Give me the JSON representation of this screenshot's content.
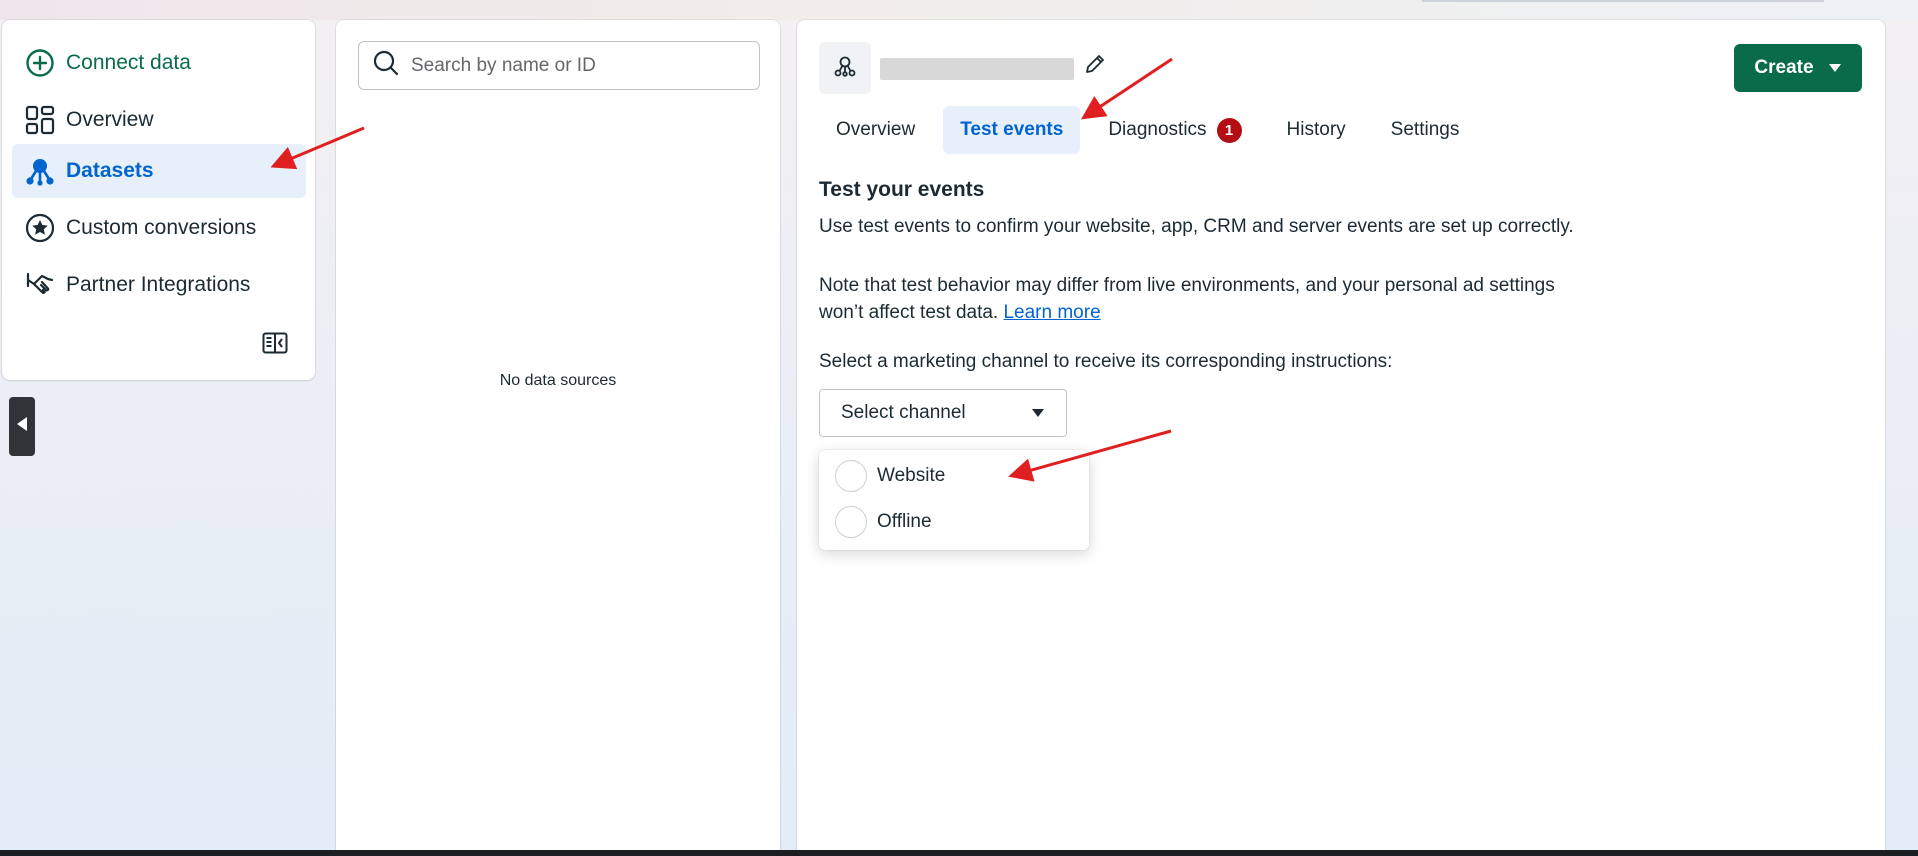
{
  "sidebar": {
    "items": [
      {
        "label": "Connect data",
        "icon": "plus-circle-icon"
      },
      {
        "label": "Overview",
        "icon": "grid-icon"
      },
      {
        "label": "Datasets",
        "icon": "dataset-icon",
        "active": true
      },
      {
        "label": "Custom conversions",
        "icon": "star-circle-icon"
      },
      {
        "label": "Partner Integrations",
        "icon": "handshake-icon"
      }
    ],
    "collapse_icon": "collapse-sidebar-icon"
  },
  "middle": {
    "search_placeholder": "Search by name or ID",
    "empty_text": "No data sources"
  },
  "main": {
    "create_label": "Create",
    "tabs": [
      {
        "label": "Overview"
      },
      {
        "label": "Test events",
        "active": true
      },
      {
        "label": "Diagnostics",
        "badge": "1"
      },
      {
        "label": "History"
      },
      {
        "label": "Settings"
      }
    ],
    "heading": "Test your events",
    "intro": "Use test events to confirm your website, app, CRM and server events are set up correctly.",
    "note": "Note that test behavior may differ from live environments, and your personal ad settings won’t affect test data.",
    "learn_more": "Learn more",
    "select_prompt": "Select a marketing channel to receive its corresponding instructions:",
    "select_label": "Select channel",
    "options": [
      {
        "label": "Website"
      },
      {
        "label": "Offline"
      }
    ]
  },
  "colors": {
    "accent_green": "#0a6b4b",
    "active_blue": "#0064d1",
    "active_bg": "#e7f0fa",
    "badge_red": "#b20e13",
    "annotation_red": "#e02020"
  }
}
